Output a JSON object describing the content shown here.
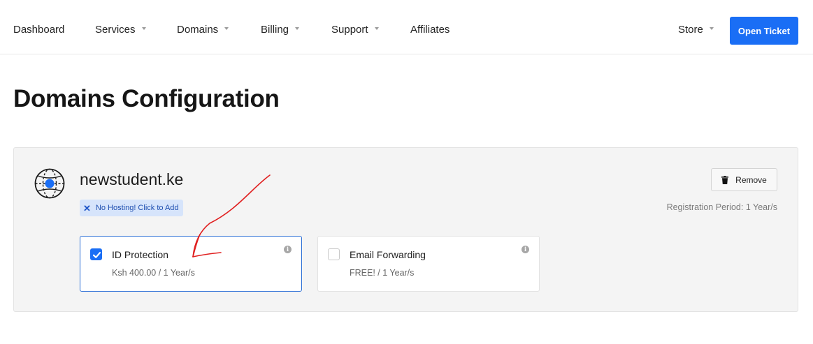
{
  "nav": {
    "items": [
      {
        "label": "Dashboard",
        "has_dropdown": false
      },
      {
        "label": "Services",
        "has_dropdown": true
      },
      {
        "label": "Domains",
        "has_dropdown": true
      },
      {
        "label": "Billing",
        "has_dropdown": true
      },
      {
        "label": "Support",
        "has_dropdown": true
      },
      {
        "label": "Affiliates",
        "has_dropdown": false
      }
    ],
    "store_label": "Store",
    "open_ticket_label": "Open Ticket"
  },
  "page": {
    "title": "Domains Configuration"
  },
  "domain": {
    "name": "newstudent.ke",
    "no_hosting_label": "No Hosting! Click to Add",
    "remove_label": "Remove",
    "registration_period": "Registration Period: 1 Year/s",
    "icon": "globe-icon"
  },
  "addons": [
    {
      "name": "ID Protection",
      "price": "Ksh 400.00 / 1 Year/s",
      "checked": true
    },
    {
      "name": "Email Forwarding",
      "price": "FREE! / 1 Year/s",
      "checked": false
    }
  ],
  "colors": {
    "accent": "#1a6ef5",
    "panel_bg": "#f4f4f4",
    "annotation": "#e02020"
  }
}
